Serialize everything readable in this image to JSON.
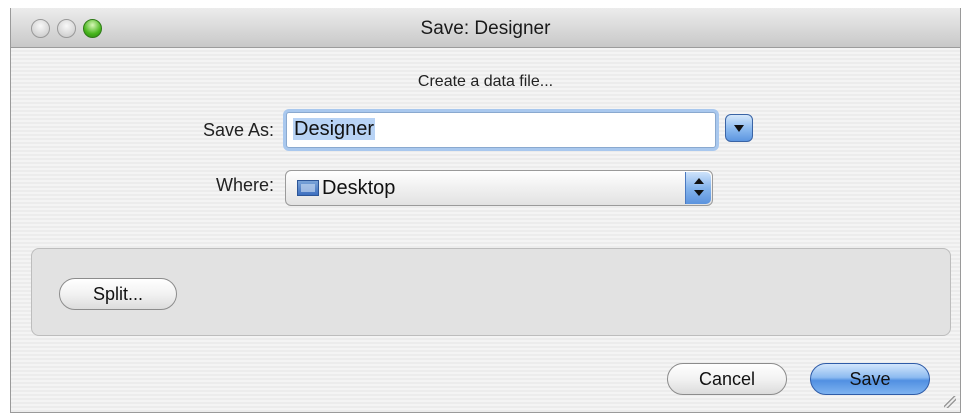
{
  "window": {
    "title": "Save: Designer"
  },
  "dialog": {
    "message": "Create a data file...",
    "save_as_label": "Save As:",
    "save_as_value": "Designer",
    "where_label": "Where:",
    "where_value": "Desktop"
  },
  "buttons": {
    "split": "Split...",
    "cancel": "Cancel",
    "save": "Save"
  },
  "icons": {
    "location": "desktop-folder-icon",
    "expand": "disclosure-triangle-icon",
    "popup": "up-down-arrows-icon"
  }
}
